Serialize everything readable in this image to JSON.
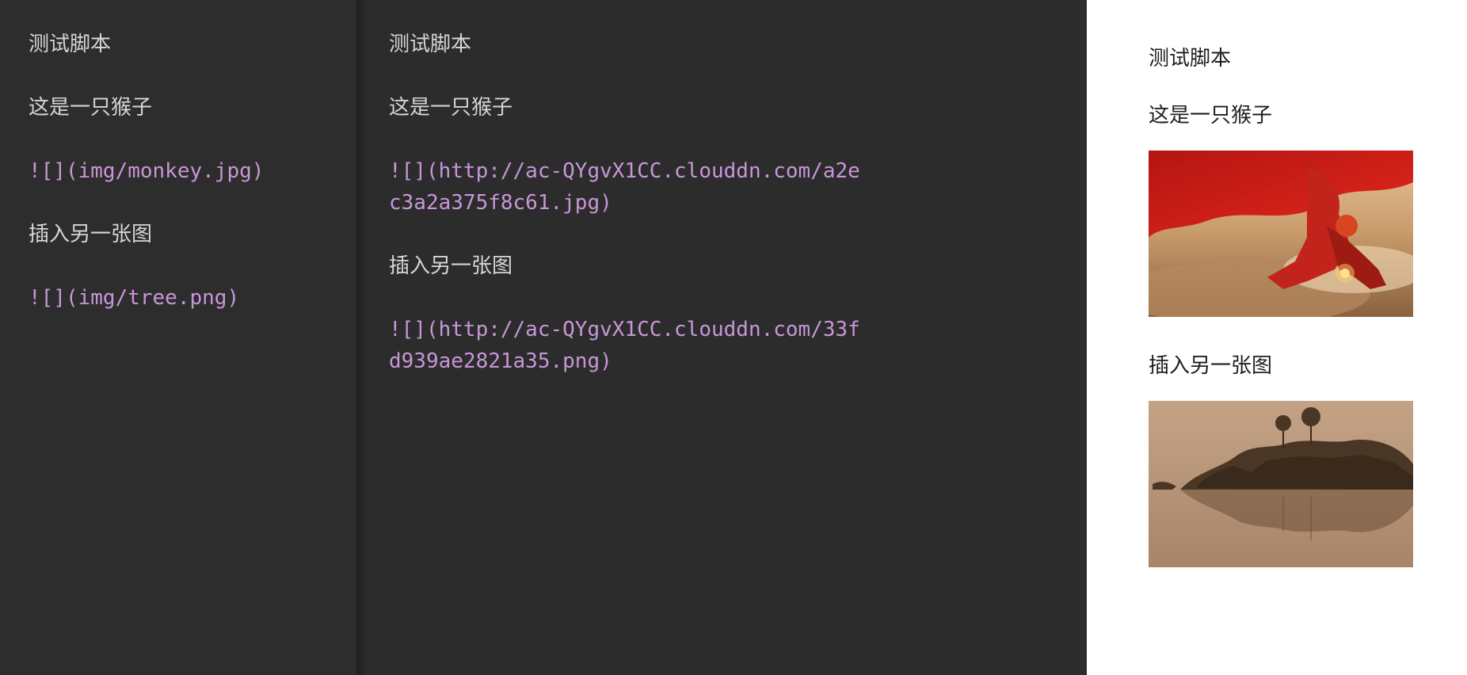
{
  "left_pane": {
    "title": "测试脚本",
    "line1": "这是一只猴子",
    "img1_md": "![](img/monkey.jpg)",
    "line2": "插入另一张图",
    "img2_md": "![](img/tree.png)"
  },
  "middle_pane": {
    "title": "测试脚本",
    "line1": "这是一只猴子",
    "img1_md": "![](http://ac-QYgvX1CC.clouddn.com/a2ec3a2a375f8c61.jpg)",
    "line2": "插入另一张图",
    "img2_md": "![](http://ac-QYgvX1CC.clouddn.com/33fd939ae2821a35.png)"
  },
  "preview_pane": {
    "title": "测试脚本",
    "line1": "这是一只猴子",
    "line2": "插入另一张图",
    "image1_icon": "monkey-image",
    "image2_icon": "tree-island-image"
  },
  "colors": {
    "editor_bg": "#2d2d2d",
    "text": "#d6d6d6",
    "code": "#c896d8",
    "preview_bg": "#ffffff"
  }
}
